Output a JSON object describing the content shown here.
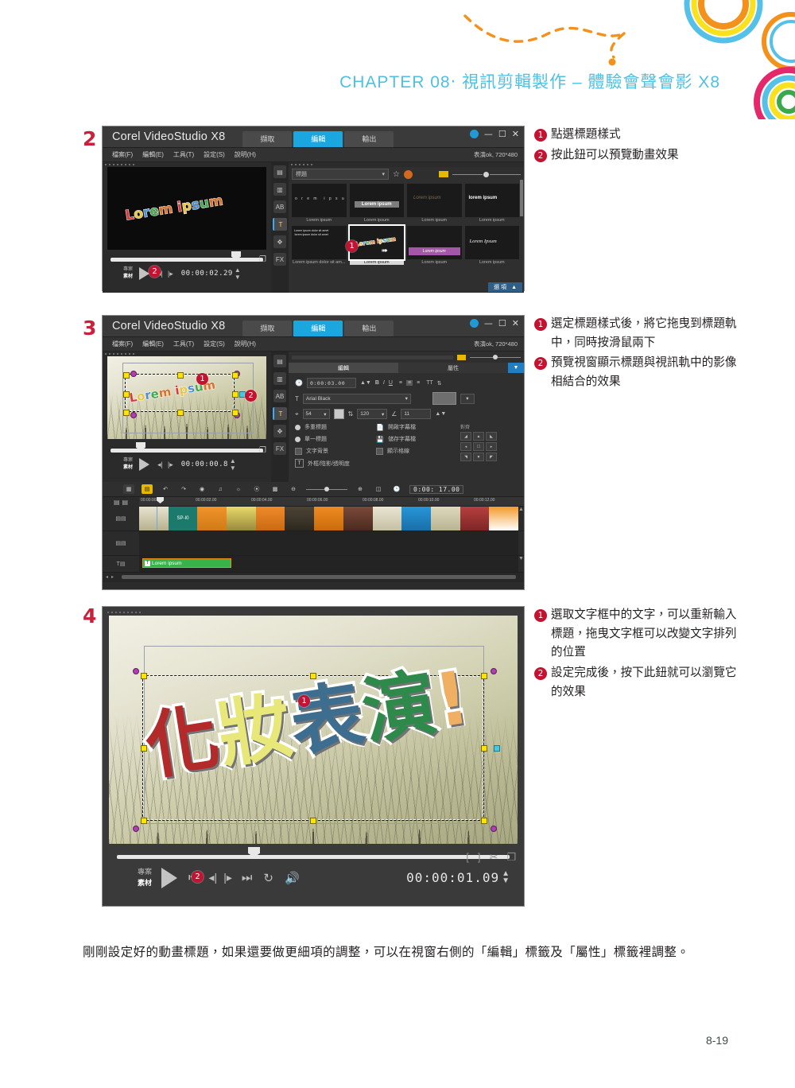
{
  "page": {
    "chapter_heading": "CHAPTER 08‧ 視訊剪輯製作 – 體驗會聲會影 X8",
    "page_number": "8-19",
    "body_paragraph": "剛剛設定好的動畫標題，如果還要做更細項的調整，可以在視窗右側的「編輯」標籤及「屬性」標籤裡調整。",
    "accent_color": "#4fc0e0",
    "marker_color": "#c41230"
  },
  "steps": [
    {
      "number": "2"
    },
    {
      "number": "3"
    },
    {
      "number": "4"
    }
  ],
  "annotations": {
    "step2": [
      {
        "bullet": "1",
        "text": "點選標題樣式"
      },
      {
        "bullet": "2",
        "text": "按此鈕可以預覽動畫效果"
      }
    ],
    "step3": [
      {
        "bullet": "1",
        "text": "選定標題樣式後，將它拖曳到標題軌中，同時按滑鼠兩下"
      },
      {
        "bullet": "2",
        "text": "預覽視窗顯示標題與視訊軌中的影像相結合的效果"
      }
    ],
    "step4": [
      {
        "bullet": "1",
        "text": "選取文字框中的文字，可以重新輸入標題，拖曳文字框可以改變文字排列的位置"
      },
      {
        "bullet": "2",
        "text": "設定完成後，按下此鈕就可以瀏覽它的效果"
      }
    ]
  },
  "app": {
    "title": "Corel VideoStudio X8",
    "tabs": [
      {
        "label": "擷取",
        "active": false
      },
      {
        "label": "編輯",
        "active": true
      },
      {
        "label": "輸出",
        "active": false
      }
    ],
    "menus": [
      "檔案(F)",
      "編輯(E)",
      "工具(T)",
      "設定(S)",
      "說明(H)"
    ],
    "project_info": "表演ok, 720*480",
    "window_buttons": [
      "globe-icon",
      "–",
      "❐",
      "✕"
    ],
    "library_sidebar": [
      {
        "name": "media-icon",
        "glyph": "▤",
        "selected": false
      },
      {
        "name": "mask-icon",
        "glyph": "▥",
        "selected": false
      },
      {
        "name": "transition-icon",
        "glyph": "AB",
        "selected": false
      },
      {
        "name": "title-icon",
        "glyph": "T",
        "selected": true
      },
      {
        "name": "graphic-icon",
        "glyph": "✥",
        "selected": false
      },
      {
        "name": "fx-icon",
        "glyph": "FX",
        "selected": false
      }
    ]
  },
  "panel2": {
    "preview": {
      "title_art": "Lorem ipsum",
      "timecode": "00:00:02.29",
      "mode_labels": {
        "project": "專案",
        "clip": "素材"
      }
    },
    "library": {
      "category": "標題",
      "options_button": "選 項",
      "thumbnails": [
        {
          "caption": "Lorem ipsum",
          "style": "spaced-thin"
        },
        {
          "caption": "Lorem ipsum",
          "style": "grey-bar"
        },
        {
          "caption": "Lorem ipsum",
          "style": "faint-italic"
        },
        {
          "caption": "Lorem ipsum",
          "style": "bold-white"
        },
        {
          "caption": "Lorem ipsum dolor sit am...",
          "style": "paragraph"
        },
        {
          "caption": "Lorem ipsum",
          "style": "colorful-selected",
          "selected": true
        },
        {
          "caption": "Lorem ipsum",
          "style": "purple-bar"
        },
        {
          "caption": "Lorem ipsum",
          "style": "serif-italic"
        }
      ]
    },
    "callouts": [
      {
        "label": "1",
        "target": "selected-title-style"
      },
      {
        "label": "2",
        "target": "play-button"
      }
    ]
  },
  "panel3": {
    "preview": {
      "title_art": "Lorem ipsum",
      "timecode": "00:00:00.8",
      "mode_labels": {
        "project": "專案",
        "clip": "素材"
      }
    },
    "edit_panel": {
      "tabs": [
        {
          "label": "編輯",
          "active": true
        },
        {
          "label": "屬性",
          "active": false
        }
      ],
      "duration": "0:00:03.00",
      "format_buttons": [
        "B",
        "I",
        "U"
      ],
      "align_buttons": [
        "⬱",
        "☰",
        "⬲"
      ],
      "text_dir_buttons": [
        "TT",
        "⇅"
      ],
      "font": "Arial Black",
      "font_size": "54",
      "line_spacing": "120",
      "angle": "11",
      "options": [
        "多重標題",
        "單一標題",
        "文字背景",
        "開啟字幕檔",
        "儲存字幕檔",
        "顯示格線",
        "外框/陰影/透明度"
      ],
      "align_group_label": "對齊"
    },
    "timeline": {
      "total_timecode": "0:00: 17.00",
      "ruler_labels": [
        "00:00:00.00",
        "00:00:02.00",
        "00:00:04.00",
        "00:00:06.00",
        "00:00:08.00",
        "00:00:10.00",
        "00:00:12.00"
      ],
      "title_clip_label": "Lorem ipsum",
      "sp_clip_label": "SP-I0"
    },
    "callouts": [
      {
        "label": "1",
        "target": "title-track-clip"
      },
      {
        "label": "2",
        "target": "preview-title-object"
      }
    ]
  },
  "panel4": {
    "title_art": {
      "characters": [
        {
          "char": "化",
          "color": "#b22a2a"
        },
        {
          "char": "妝",
          "color": "#e8e87a"
        },
        {
          "char": "表",
          "color": "#3d6e90"
        },
        {
          "char": "演",
          "color": "#2e8a4a"
        },
        {
          "char": "!",
          "color": "#efb064"
        }
      ]
    },
    "timecode": "00:00:01.09",
    "mode_labels": {
      "project": "專案",
      "clip": "素材"
    },
    "transport_icons": [
      "play",
      "home",
      "prev-frame",
      "next-frame",
      "end",
      "loop",
      "volume"
    ],
    "right_tools": [
      "mark-in",
      "mark-out",
      "cut-icon",
      "capture-icon"
    ],
    "callouts": [
      {
        "label": "1",
        "target": "text-box-selection"
      },
      {
        "label": "2",
        "target": "play-button"
      }
    ]
  }
}
